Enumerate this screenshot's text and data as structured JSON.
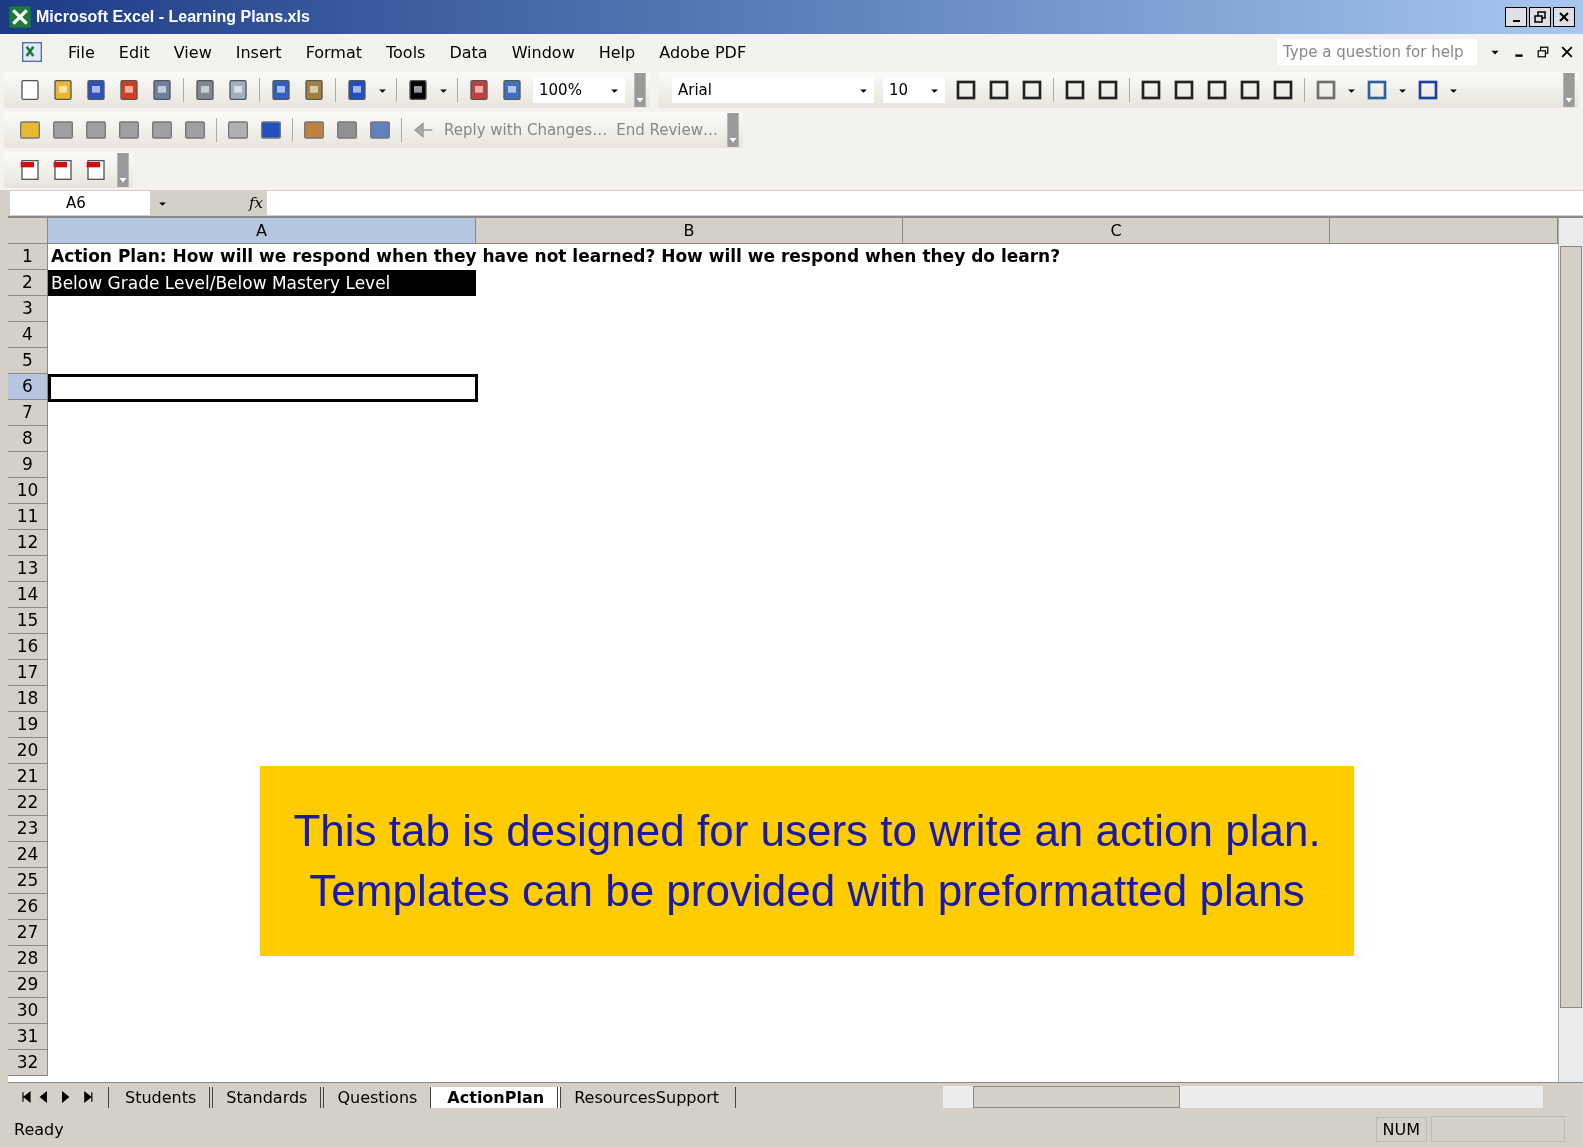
{
  "window": {
    "title": "Microsoft Excel - Learning Plans.xls"
  },
  "menu": [
    {
      "label": "File"
    },
    {
      "label": "Edit"
    },
    {
      "label": "View"
    },
    {
      "label": "Insert"
    },
    {
      "label": "Format"
    },
    {
      "label": "Tools"
    },
    {
      "label": "Data"
    },
    {
      "label": "Window"
    },
    {
      "label": "Help"
    },
    {
      "label": "Adobe PDF"
    }
  ],
  "help_box": {
    "placeholder": "Type a question for help"
  },
  "toolbar": {
    "zoom": "100%",
    "font": "Arial",
    "font_size": "10"
  },
  "review_toolbar": {
    "reply": "Reply with Changes…",
    "end_review": "End Review…"
  },
  "formula_bar": {
    "name_box": "A6",
    "fx": "fx"
  },
  "sheet": {
    "columns": [
      {
        "label": "A",
        "selected": true
      },
      {
        "label": "B",
        "selected": false
      },
      {
        "label": "C",
        "selected": false
      }
    ],
    "rows": [
      {
        "number": "1",
        "selected": false,
        "kind": "heading",
        "text": "Action Plan: How will we respond when they have not learned?  How will we respond when they do learn?"
      },
      {
        "number": "2",
        "selected": false,
        "kind": "filled",
        "text": "Below Grade Level/Below Mastery Level"
      },
      {
        "number": "3",
        "selected": false
      },
      {
        "number": "4",
        "selected": false
      },
      {
        "number": "5",
        "selected": false
      },
      {
        "number": "6",
        "selected": true
      },
      {
        "number": "7",
        "selected": false
      },
      {
        "number": "8",
        "selected": false
      },
      {
        "number": "9",
        "selected": false
      },
      {
        "number": "10",
        "selected": false
      },
      {
        "number": "11",
        "selected": false
      },
      {
        "number": "12",
        "selected": false
      },
      {
        "number": "13",
        "selected": false
      },
      {
        "number": "14",
        "selected": false
      },
      {
        "number": "15",
        "selected": false
      },
      {
        "number": "16",
        "selected": false
      },
      {
        "number": "17",
        "selected": false
      },
      {
        "number": "18",
        "selected": false
      },
      {
        "number": "19",
        "selected": false
      },
      {
        "number": "20",
        "selected": false
      },
      {
        "number": "21",
        "selected": false
      },
      {
        "number": "22",
        "selected": false
      },
      {
        "number": "23",
        "selected": false
      },
      {
        "number": "24",
        "selected": false
      },
      {
        "number": "25",
        "selected": false
      },
      {
        "number": "26",
        "selected": false
      },
      {
        "number": "27",
        "selected": false
      },
      {
        "number": "28",
        "selected": false
      },
      {
        "number": "29",
        "selected": false
      },
      {
        "number": "30",
        "selected": false
      },
      {
        "number": "31",
        "selected": false
      },
      {
        "number": "32",
        "selected": false
      }
    ]
  },
  "callout": {
    "lines": [
      "This tab is designed for users to write an action plan.",
      "Templates can be provided with preformatted plans"
    ]
  },
  "sheet_tabs": [
    {
      "label": "Students",
      "selected": false
    },
    {
      "label": "Standards",
      "selected": false
    },
    {
      "label": "Questions",
      "selected": false
    },
    {
      "label": "ActionPlan",
      "selected": true
    },
    {
      "label": "ResourcesSupport",
      "selected": false
    }
  ],
  "status_bar": {
    "status": "Ready",
    "num": "NUM"
  }
}
